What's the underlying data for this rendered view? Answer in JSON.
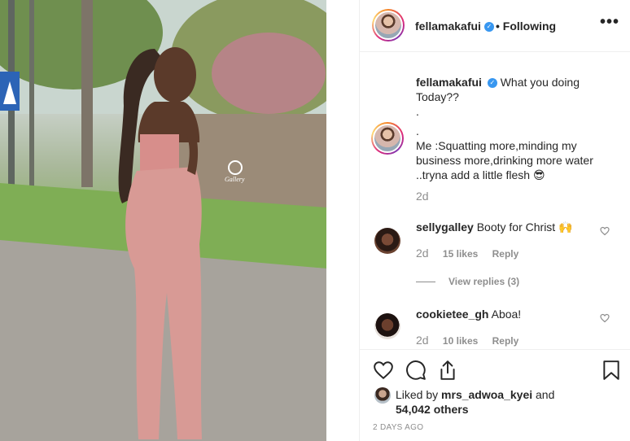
{
  "post": {
    "username": "fellamakafui",
    "verified_mark": "✓",
    "following_label": "• Following",
    "more_label": "•••",
    "watermark": "Gallery"
  },
  "caption": {
    "username": "fellamakafui",
    "line1": "What you doing",
    "line2": "Today??",
    "line3": ".",
    "line4": ".",
    "line5": "Me :Squatting more,minding my",
    "line6": "business more,drinking more water",
    "line7": "..tryna add a little flesh",
    "emoji": "😎",
    "age": "2d"
  },
  "comments": [
    {
      "username": "sellygalley",
      "text": "Booty for Christ",
      "emoji": "🙌",
      "age": "2d",
      "likes": "15 likes",
      "reply": "Reply",
      "view_replies": "View replies (3)"
    },
    {
      "username": "cookietee_gh",
      "text": "Aboa!",
      "age": "2d",
      "likes": "10 likes",
      "reply": "Reply"
    }
  ],
  "actions": {
    "icons": [
      "heart-icon",
      "comment-icon",
      "share-icon",
      "bookmark-icon"
    ]
  },
  "likes": {
    "prefix": "Liked by",
    "user": "mrs_adwoa_kyei",
    "conj": "and",
    "count": "54,042 others"
  },
  "posted": "2 DAYS AGO",
  "colors": {
    "link_blue": "#3897f0",
    "text": "#262626",
    "muted": "#8e8e8e",
    "divider": "#efefef"
  }
}
